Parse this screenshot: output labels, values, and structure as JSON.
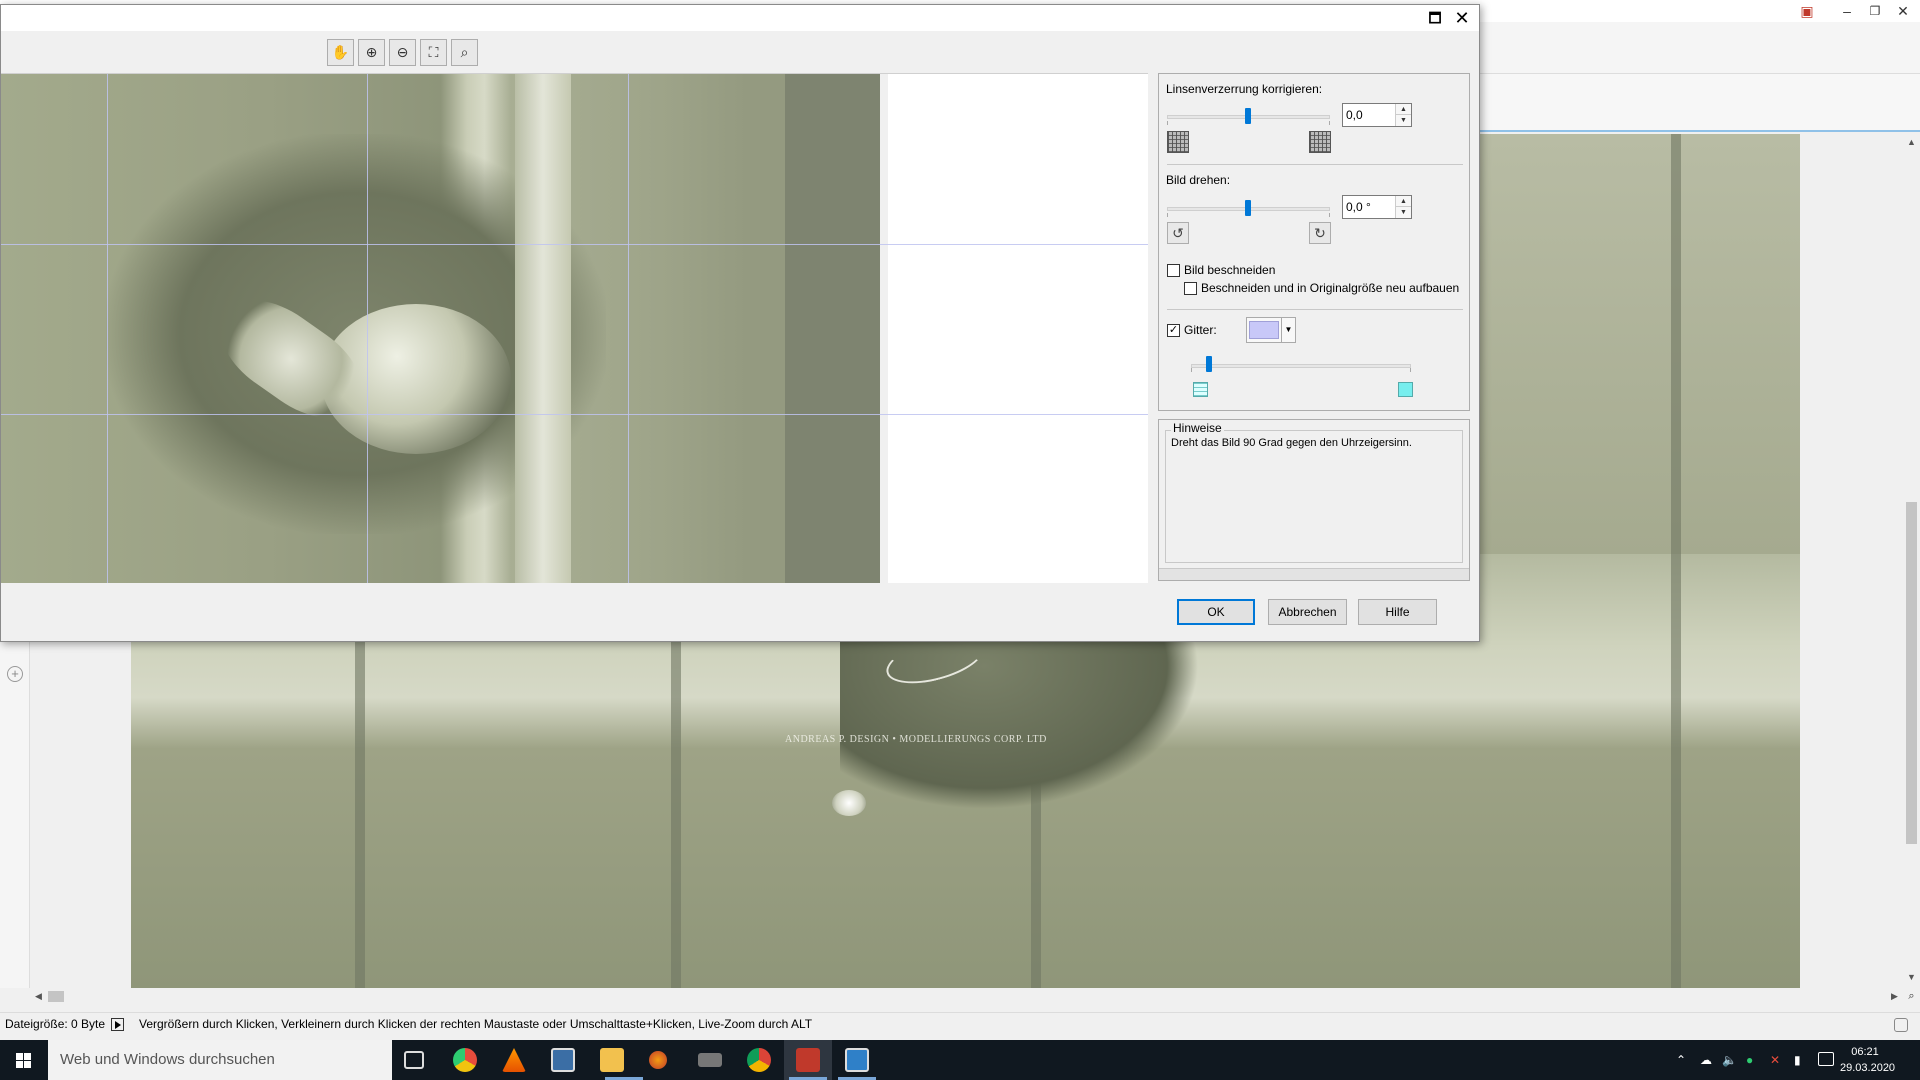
{
  "dialog": {
    "tools": [
      {
        "icon": "hand-icon",
        "glyph": "✋"
      },
      {
        "icon": "zoom-in-icon",
        "glyph": "⊕"
      },
      {
        "icon": "zoom-out-icon",
        "glyph": "⊖"
      },
      {
        "icon": "fit-to-window-icon",
        "glyph": "⛶"
      },
      {
        "icon": "actual-size-icon",
        "glyph": "⌕"
      }
    ],
    "lens_label": "Linsenverzerrung korrigieren:",
    "lens_value": "0,0",
    "rotate_label": "Bild drehen:",
    "rotate_value": "0,0 °",
    "crop_label": "Bild beschneiden",
    "crop_checked": false,
    "crop_rebuild_label": "Beschneiden und in Originalgröße neu aufbauen",
    "crop_rebuild_checked": false,
    "grid_label": "Gitter:",
    "grid_checked": true,
    "grid_color": "#c8c8f8",
    "hints_title": "Hinweise",
    "hints_text": "Dreht das Bild 90 Grad gegen den Uhrzeigersinn.",
    "ok_label": "OK",
    "cancel_label": "Abbrechen",
    "help_label": "Hilfe"
  },
  "background": {
    "watermark": "ANDREAS P. DESIGN • MODELLIERUNGS CORP. LTD"
  },
  "statusbar": {
    "file_size": "Dateigröße: 0 Byte",
    "hint": "Vergrößern durch Klicken, Verkleinern durch Klicken der rechten Maustaste oder Umschalttaste+Klicken, Live-Zoom durch ALT"
  },
  "taskbar": {
    "search_placeholder": "Web und Windows durchsuchen",
    "time": "06:21",
    "date": "29.03.2020"
  }
}
